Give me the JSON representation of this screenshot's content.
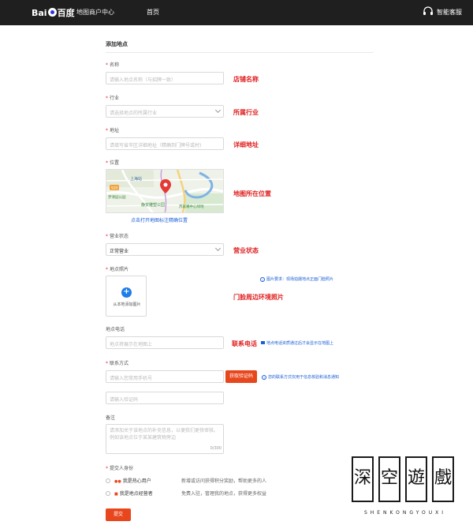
{
  "header": {
    "logo_text_a": "Bai",
    "logo_text_b": "百度",
    "system_title": "地图商户中心",
    "nav_home": "首页",
    "support_label": "智能客服"
  },
  "form": {
    "title": "添加地点",
    "name": {
      "label": "名称",
      "placeholder": "请输入地点名称（与招牌一致）",
      "annotation": "店铺名称"
    },
    "industry": {
      "label": "行业",
      "placeholder": "请选择地点的所属行业",
      "annotation": "所属行业"
    },
    "address": {
      "label": "地址",
      "placeholder": "请填写省市区详细地址（精确到门牌号或村)",
      "annotation": "详细地址"
    },
    "location": {
      "label": "位置",
      "annotation": "地图所在位置",
      "map_link": "点击打开地图标注精确位置",
      "map_labels": {
        "station": "上海站",
        "district": "梦清园公园",
        "park": "静安雕塑公园",
        "center": "苏家嘴中心绿地",
        "code": "S20"
      }
    },
    "status": {
      "label": "营业状态",
      "value": "正常营业",
      "annotation": "营业状态"
    },
    "photo": {
      "label": "地点照片",
      "upload_text": "从本地添加图片",
      "hint": "图片要求：现场拍摄地点正面门脸照片",
      "annotation": "门脸周边环境照片"
    },
    "phone": {
      "label": "地点电话",
      "placeholder": "地点将展示在地图上",
      "annotation": "联系电话",
      "hint": "地点电话资质通过后才会显示在地图上"
    },
    "contact": {
      "label": "联系方式",
      "phone_placeholder": "请输入您常用手机号",
      "code_button": "获取验证码",
      "hint": "您的联系方式仅用于信息核验和消息通知",
      "code_placeholder": "请输入验证码"
    },
    "notes": {
      "label": "备注",
      "placeholder": "请添加关于该地点的补充信息，以便我们更快审核。例如该地点位于某某建筑物旁边",
      "counter": "0/300"
    },
    "identity": {
      "label": "提交人身份",
      "options": [
        {
          "label": "我是热心用户",
          "desc": "新增或访问获得积分奖励，帮助更多的人"
        },
        {
          "label": "我是地点经营者",
          "desc": "免费入驻，管理我的地点，获得更多权益"
        }
      ]
    },
    "submit": "提交"
  },
  "watermark": {
    "chars": [
      "深",
      "空",
      "遊",
      "戲"
    ],
    "subtitle": "SHENKONGYOUXI"
  },
  "colors": {
    "accent": "#e8461c",
    "annotation": "#e02020",
    "link": "#1a5fd6",
    "topbar": "#1f1f1f"
  }
}
